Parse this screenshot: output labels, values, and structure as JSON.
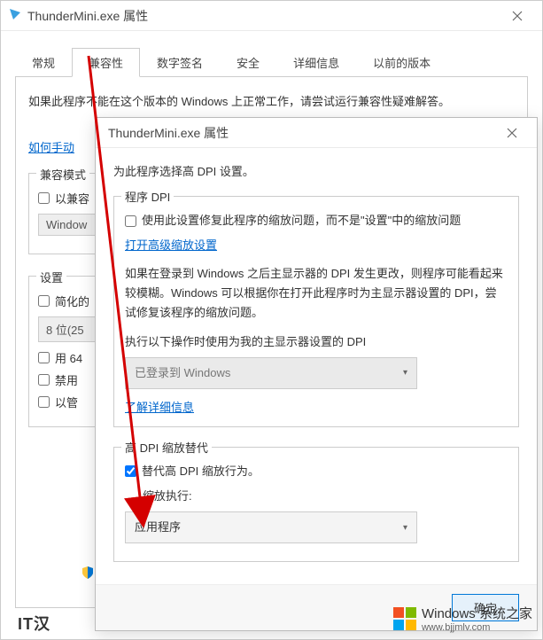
{
  "main": {
    "title": "ThunderMini.exe 属性",
    "tabs": [
      "常规",
      "兼容性",
      "数字签名",
      "安全",
      "详细信息",
      "以前的版本"
    ],
    "active_tab_index": 1,
    "intro": "如果此程序不能在这个版本的 Windows 上正常工作，请尝试运行兼容性疑难解答。",
    "manual_link": "如何手动",
    "compat_group_title": "兼容模式",
    "compat_checkbox": "以兼容",
    "compat_os": "Window",
    "settings_group_title": "设置",
    "reduced_color": "简化的",
    "color_depth": "8 位(25",
    "res640": "用 64",
    "disable_label": "禁用",
    "admin_label": "以管"
  },
  "sub": {
    "title": "ThunderMini.exe 属性",
    "heading": "为此程序选择高 DPI 设置。",
    "program_dpi_title": "程序 DPI",
    "use_setting_checkbox": "使用此设置修复此程序的缩放问题，而不是\"设置\"中的缩放问题",
    "open_advanced_link": "打开高级缩放设置",
    "dpi_change_desc": "如果在登录到 Windows 之后主显示器的 DPI 发生更改，则程序可能看起来较模糊。Windows 可以根据你在打开此程序时为主显示器设置的 DPI，尝试修复该程序的缩放问题。",
    "when_label": "执行以下操作时使用为我的主显示器设置的 DPI",
    "when_dropdown": "已登录到 Windows",
    "learn_more_link": "了解详细信息",
    "override_title": "高 DPI 缩放替代",
    "override_checkbox": "替代高 DPI 缩放行为。",
    "override_sublabel": "缩放执行:",
    "override_dropdown": "应用程序",
    "ok_btn": "确定"
  },
  "watermark": {
    "brand": "Windows",
    "sub": "系统之家",
    "url": "www.bjjmlv.com"
  },
  "corner_text": "IT汉"
}
